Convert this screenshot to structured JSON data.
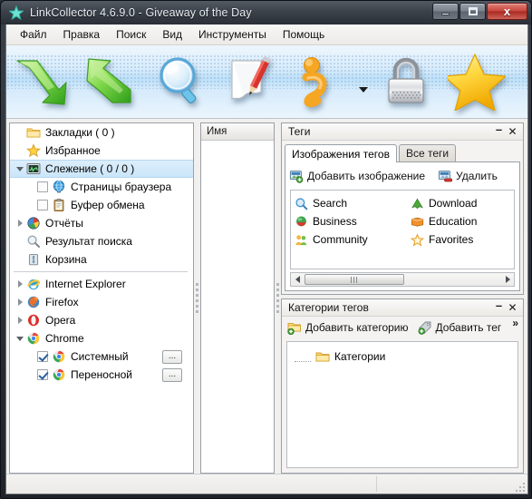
{
  "window": {
    "title": "LinkCollector 4.6.9.0 - Giveaway of the Day",
    "icon": "star-icon",
    "buttons": {
      "minimize": "minimize-button",
      "maximize": "maximize-button",
      "close_label": "x"
    }
  },
  "menu": {
    "items": [
      {
        "label": "Файл"
      },
      {
        "label": "Правка"
      },
      {
        "label": "Поиск"
      },
      {
        "label": "Вид"
      },
      {
        "label": "Инструменты"
      },
      {
        "label": "Помощь"
      }
    ]
  },
  "toolbar": {
    "buttons": [
      {
        "name": "import-down-arrow-icon"
      },
      {
        "name": "export-up-arrow-icon"
      },
      {
        "name": "magnifier-search-icon"
      },
      {
        "name": "notepad-pencil-edit-icon"
      },
      {
        "name": "signature-person-icon"
      },
      {
        "name": "padlock-lock-icon"
      },
      {
        "name": "yellow-star-favorites-icon"
      }
    ],
    "dropdown_arrow": "chevron-down-icon"
  },
  "tree": {
    "items": [
      {
        "label": "Закладки ( 0 )",
        "icon": "folder-icon",
        "indent": 1,
        "expander": "none",
        "checkbox": "none",
        "selected": false
      },
      {
        "label": "Избранное",
        "icon": "star-icon",
        "indent": 1,
        "expander": "none",
        "checkbox": "none",
        "selected": false
      },
      {
        "label": "Слежение ( 0 / 0 )",
        "icon": "monitor-icon",
        "indent": 0,
        "expander": "open",
        "checkbox": "none",
        "selected": true
      },
      {
        "label": "Страницы браузера",
        "icon": "globe-icon",
        "indent": 2,
        "expander": "none",
        "checkbox": "off",
        "selected": false
      },
      {
        "label": "Буфер обмена",
        "icon": "clipboard-icon",
        "indent": 2,
        "expander": "none",
        "checkbox": "off",
        "selected": false
      },
      {
        "label": "Отчёты",
        "icon": "piechart-icon",
        "indent": 0,
        "expander": "closed",
        "checkbox": "none",
        "selected": false
      },
      {
        "label": "Результат поиска",
        "icon": "magnifier-icon",
        "indent": 1,
        "expander": "none",
        "checkbox": "none",
        "selected": false
      },
      {
        "label": "Корзина",
        "icon": "recyclebin-icon",
        "indent": 1,
        "expander": "none",
        "checkbox": "none",
        "selected": false
      },
      {
        "label": "Internet Explorer",
        "icon": "ie-icon",
        "indent": 0,
        "expander": "closed",
        "checkbox": "none",
        "selected": false
      },
      {
        "label": "Firefox",
        "icon": "firefox-icon",
        "indent": 0,
        "expander": "closed",
        "checkbox": "none",
        "selected": false
      },
      {
        "label": "Opera",
        "icon": "opera-icon",
        "indent": 0,
        "expander": "closed",
        "checkbox": "none",
        "selected": false
      },
      {
        "label": "Chrome",
        "icon": "chrome-icon",
        "indent": 0,
        "expander": "open",
        "checkbox": "none",
        "selected": false
      },
      {
        "label": "Системный",
        "icon": "chrome-icon",
        "indent": 2,
        "expander": "none",
        "checkbox": "on",
        "selected": false,
        "more_button": "..."
      },
      {
        "label": "Переносной",
        "icon": "chrome-icon",
        "indent": 2,
        "expander": "none",
        "checkbox": "on",
        "selected": false,
        "more_button": "..."
      }
    ]
  },
  "name_pane": {
    "column_header": "Имя"
  },
  "tags_panel": {
    "title": "Теги",
    "tabs": [
      {
        "label": "Изображения тегов",
        "active": true
      },
      {
        "label": "Все теги",
        "active": false
      }
    ],
    "commands": [
      {
        "label": "Добавить изображение",
        "icon": "add-image-icon"
      },
      {
        "label": "Удалить",
        "icon": "delete-image-icon"
      }
    ],
    "tags_col1": [
      {
        "label": "Search",
        "icon": "magnifier-icon"
      },
      {
        "label": "Business",
        "icon": "green-sphere-icon"
      },
      {
        "label": "Community",
        "icon": "people-icon"
      }
    ],
    "tags_col2": [
      {
        "label": "Download",
        "icon": "green-up-arrow-icon"
      },
      {
        "label": "Education",
        "icon": "orange-book-icon"
      },
      {
        "label": "Favorites",
        "icon": "star-outline-icon"
      }
    ],
    "scrollbar": "horizontal-scrollbar"
  },
  "categories_panel": {
    "title": "Категории тегов",
    "commands": [
      {
        "label": "Добавить категорию",
        "icon": "add-folder-icon"
      },
      {
        "label": "Добавить тег",
        "icon": "add-tag-icon"
      }
    ],
    "overflow": "»",
    "tree": [
      {
        "label": "Категории",
        "icon": "folder-icon"
      }
    ]
  },
  "statusbar": {
    "left_text": "",
    "right_text": ""
  },
  "colors": {
    "accent": "#cbe6fa",
    "title_bg": "#3c424a",
    "close_red": "#c8453c",
    "toolbar_blue": "#bfe0f7"
  }
}
